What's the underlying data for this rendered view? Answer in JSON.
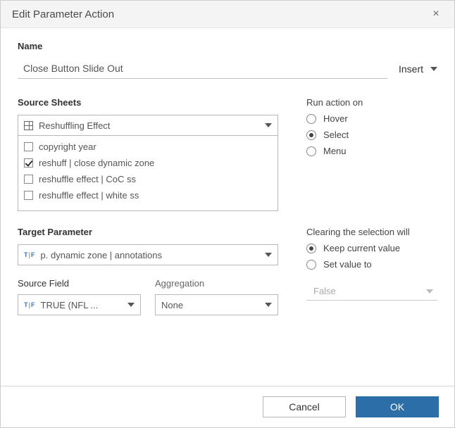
{
  "header": {
    "title": "Edit Parameter Action"
  },
  "name": {
    "label": "Name",
    "value": "Close Button Slide Out",
    "insert": "Insert"
  },
  "source_sheets": {
    "label": "Source Sheets",
    "selected": "Reshuffling Effect",
    "items": [
      {
        "label": "copyright year",
        "checked": false
      },
      {
        "label": "reshuff | close dynamic zone",
        "checked": true
      },
      {
        "label": "reshuffle effect | CoC ss",
        "checked": false
      },
      {
        "label": "reshuffle effect | white ss",
        "checked": false
      }
    ]
  },
  "run_action": {
    "label": "Run action on",
    "options": [
      {
        "label": "Hover",
        "checked": false
      },
      {
        "label": "Select",
        "checked": true
      },
      {
        "label": "Menu",
        "checked": false
      }
    ]
  },
  "target_parameter": {
    "label": "Target Parameter",
    "value": "p. dynamic zone | annotations"
  },
  "clearing": {
    "label": "Clearing the selection will",
    "options": [
      {
        "label": "Keep current value",
        "checked": true
      },
      {
        "label": "Set value to",
        "checked": false
      }
    ],
    "set_value_placeholder": "False"
  },
  "source_field": {
    "label": "Source Field",
    "value": "TRUE (NFL ..."
  },
  "aggregation": {
    "label": "Aggregation",
    "value": "None"
  },
  "footer": {
    "cancel": "Cancel",
    "ok": "OK"
  }
}
